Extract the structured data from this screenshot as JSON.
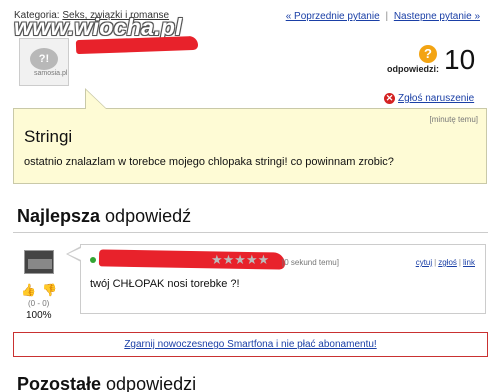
{
  "breadcrumb": {
    "prefix": "Kategoria:",
    "category": "Seks, związki i romanse"
  },
  "nav": {
    "prev": "« Poprzednie pytanie",
    "separator": "|",
    "next": "Nastepne pytanie »"
  },
  "watermark": {
    "text": "www.wiocha.pl"
  },
  "asker": {
    "avatar_label": "samosia.pl"
  },
  "answers": {
    "label": "odpowiedzi:",
    "count": "10",
    "icon": "question-icon"
  },
  "report": {
    "label": "Zgłoś naruszenie",
    "icon": "report-icon"
  },
  "question": {
    "time": "[minutę temu]",
    "title": "Stringi",
    "body": "ostatnio znalazlam w torebce mojego chlopaka stringi! co powinnam zrobic?"
  },
  "best_answer": {
    "heading_bold": "Najlepsza",
    "heading_rest": " odpowiedź",
    "stars": "★★★★★",
    "rating": 0,
    "time": "[0 sekund temu]",
    "actions": [
      "cytuj",
      "zgłoś",
      "link"
    ],
    "text": "twój CHŁOPAK nosi torebke ?!",
    "votes": "(0 - 0)",
    "percent": "100%"
  },
  "promo": {
    "label": "Zgarnij nowoczesnego Smartfona  i nie płać abonamentu!"
  },
  "others": {
    "heading_bold": "Pozostałe",
    "heading_rest": " odpowiedzi"
  },
  "colors": {
    "link": "#1a3fa6",
    "question_bg": "#fefbd5",
    "redaction": "#e8222b",
    "promo_border": "#c93131"
  }
}
